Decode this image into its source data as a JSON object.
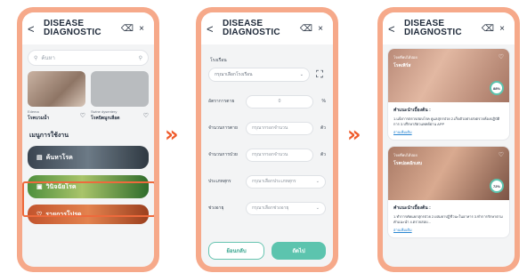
{
  "app": {
    "title_line1": "DISEASE",
    "title_line2": "DIAGNOSTIC",
    "back_glyph": "<",
    "close_glyph": "×",
    "trash_glyph": "⌫"
  },
  "arrows": {
    "first": "»",
    "second": "»"
  },
  "screen1": {
    "search_placeholder": "ค้นหา",
    "thumbs": [
      {
        "en": "Edema",
        "th": "โรคบวมน้ำ"
      },
      {
        "en": "Swine dysentery",
        "th": "โรคบิดมูกเลือด"
      }
    ],
    "menu_title": "เมนูการใช้งาน",
    "menu": [
      {
        "label": "ค้นหาโรค"
      },
      {
        "label": "วินิจฉัยโรค"
      },
      {
        "label": "รายการโปรด"
      }
    ]
  },
  "screen2": {
    "section_label": "โรงเรือน",
    "select_placeholder": "กรุณาเลือกโรงเรือน",
    "rows": [
      {
        "label": "อัตราการตาย",
        "value": "0",
        "unit": "%"
      },
      {
        "label": "จำนวนการตาย",
        "value": "กรุณากรอกจำนวน",
        "unit": "ตัว"
      },
      {
        "label": "จำนวนการป่วย",
        "value": "กรุณากรอกจำนวน",
        "unit": "ตัว"
      },
      {
        "label": "ประเภทสุกร",
        "value": "กรุณาเลือกประเภทสุกร",
        "unit": ""
      },
      {
        "label": "ช่วงอายุ",
        "value": "กรุณาเลือกช่วงอายุ",
        "unit": ""
      }
    ],
    "back_button": "ย้อนกลับ",
    "next_button": "ถัดไป"
  },
  "screen3": {
    "results": [
      {
        "tag": "โรคที่พบได้บ่อย",
        "name": "โรคเพิร์ส",
        "percent": "88%",
        "advice_title": "คำแนะนำเบื้องต้น :",
        "advice": "1.แจ้งการตรวจสอบโรค ดูแลสุกรป่วย 2.เก็บตัวอย่างส่งตรวจห้องปฏิบัติการ 3.ปรึกษาสัตวแพทย์ผ่าน APP",
        "more": "อ่านเพิ่มเติม"
      },
      {
        "tag": "โรคที่พบได้บ่อย",
        "name": "โรคปอดอักเสบ",
        "percent": "72%",
        "advice_title": "คำแนะนำเบื้องต้น :",
        "advice": "1.ทำการคัดแยกสุกรป่วย 2.ผสมยาปฏิชีวนะในอาหาร 3.ทำการรักษาตามคำแนะนำ 4.ตรวจสอบ...",
        "more": "อ่านเพิ่มเติม"
      }
    ]
  }
}
